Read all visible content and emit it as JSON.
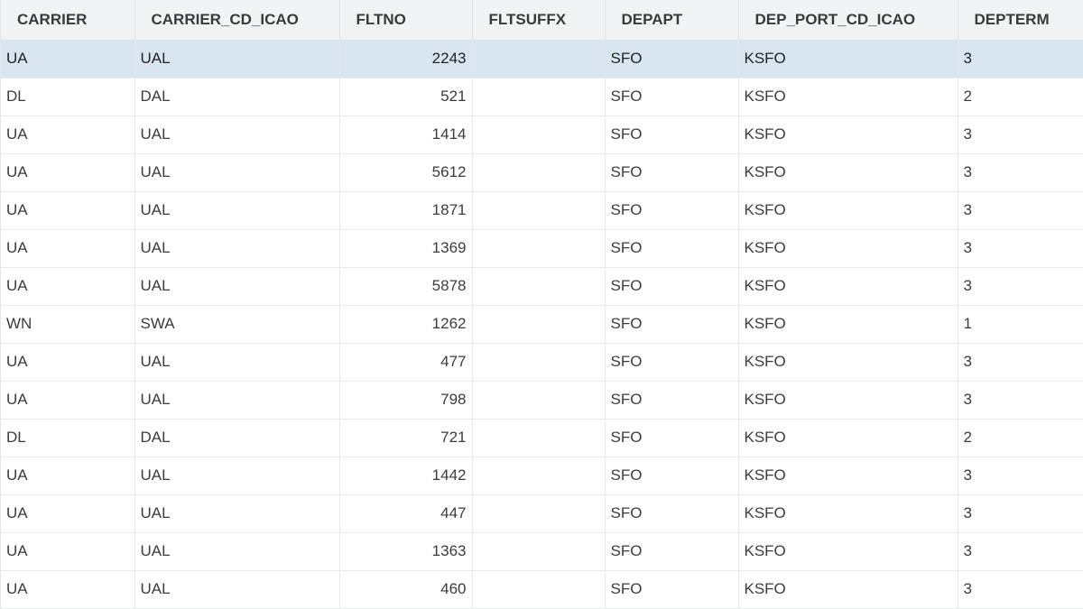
{
  "columns": [
    "CARRIER",
    "CARRIER_CD_ICAO",
    "FLTNO",
    "FLTSUFFX",
    "DEPAPT",
    "DEP_PORT_CD_ICAO",
    "DEPTERM"
  ],
  "selected_row": 0,
  "colors": {
    "selection": "#d9e6f1",
    "header_bg": "#f2f3f5"
  },
  "rows": [
    [
      "UA",
      "UAL",
      "2243",
      "",
      "SFO",
      "KSFO",
      "3"
    ],
    [
      "DL",
      "DAL",
      "521",
      "",
      "SFO",
      "KSFO",
      "2"
    ],
    [
      "UA",
      "UAL",
      "1414",
      "",
      "SFO",
      "KSFO",
      "3"
    ],
    [
      "UA",
      "UAL",
      "5612",
      "",
      "SFO",
      "KSFO",
      "3"
    ],
    [
      "UA",
      "UAL",
      "1871",
      "",
      "SFO",
      "KSFO",
      "3"
    ],
    [
      "UA",
      "UAL",
      "1369",
      "",
      "SFO",
      "KSFO",
      "3"
    ],
    [
      "UA",
      "UAL",
      "5878",
      "",
      "SFO",
      "KSFO",
      "3"
    ],
    [
      "WN",
      "SWA",
      "1262",
      "",
      "SFO",
      "KSFO",
      "1"
    ],
    [
      "UA",
      "UAL",
      "477",
      "",
      "SFO",
      "KSFO",
      "3"
    ],
    [
      "UA",
      "UAL",
      "798",
      "",
      "SFO",
      "KSFO",
      "3"
    ],
    [
      "DL",
      "DAL",
      "721",
      "",
      "SFO",
      "KSFO",
      "2"
    ],
    [
      "UA",
      "UAL",
      "1442",
      "",
      "SFO",
      "KSFO",
      "3"
    ],
    [
      "UA",
      "UAL",
      "447",
      "",
      "SFO",
      "KSFO",
      "3"
    ],
    [
      "UA",
      "UAL",
      "1363",
      "",
      "SFO",
      "KSFO",
      "3"
    ],
    [
      "UA",
      "UAL",
      "460",
      "",
      "SFO",
      "KSFO",
      "3"
    ]
  ]
}
